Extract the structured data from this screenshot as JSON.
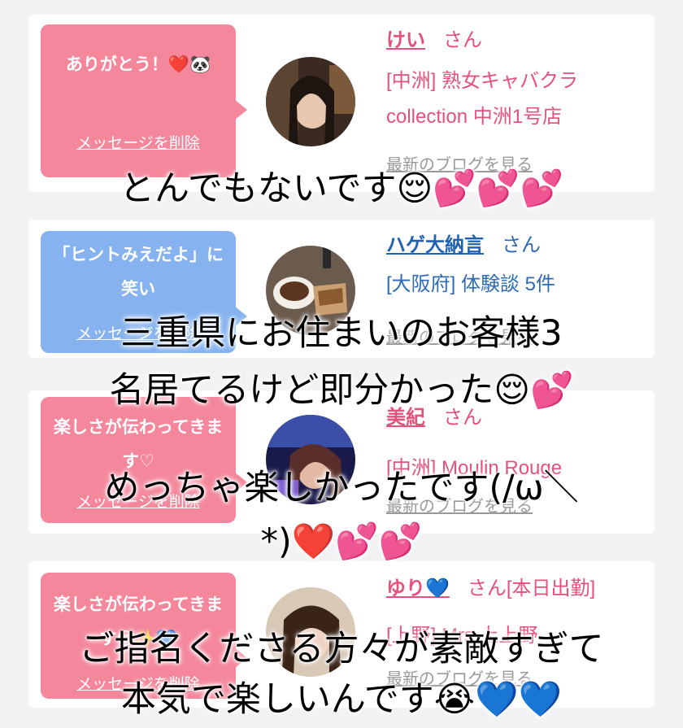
{
  "messages": [
    {
      "bubble_text": "ありがとう！❤️🐼",
      "delete_label": "メッセージを削除",
      "name": "けい",
      "suffix": "さん",
      "shop_line1": "[中洲] 熟女キャバクラ",
      "shop_line2": "collection 中洲1号店",
      "blog_link": "最新のブログを見る"
    },
    {
      "bubble_text": "「ヒントみえだよ」に笑い",
      "delete_label": "メッセージを削除",
      "name": "ハゲ大納言",
      "suffix": "さん",
      "shop_line1": "[大阪府] 体験談 5件",
      "blog_link": "最新のブログを見る"
    },
    {
      "bubble_text": "楽しさが伝わってきます♡",
      "delete_label": "メッセージを削除",
      "name": "美紀",
      "suffix": "さん",
      "shop_line1": "[中洲] Moulin Rouge",
      "blog_link": "最新のブログを見る"
    },
    {
      "bubble_text": "楽しさが伝わってきます😊✨💙",
      "delete_label": "メッセージを削除",
      "name": "ゆり💙",
      "suffix": "さん[本日出勤]",
      "shop_line1": "[上野] Mrs.上上野",
      "blog_link": "最新のブログを見る"
    }
  ],
  "captions": [
    "とんでもないです😌💕💕💕",
    "三重県にお住まいのお客様3",
    "名居てるけど即分かった😌💕",
    "めっちゃ楽しかったです(/ω＼",
    "*)❤️💕💕",
    "ご指名くださる方々が素敵すぎて",
    "本気で楽しいんです😭💙💙"
  ],
  "colors": {
    "pink_bubble": "#f4879b",
    "blue_bubble": "#86b3ef",
    "pink_text": "#e5517b",
    "blue_link": "#1f62b4"
  }
}
